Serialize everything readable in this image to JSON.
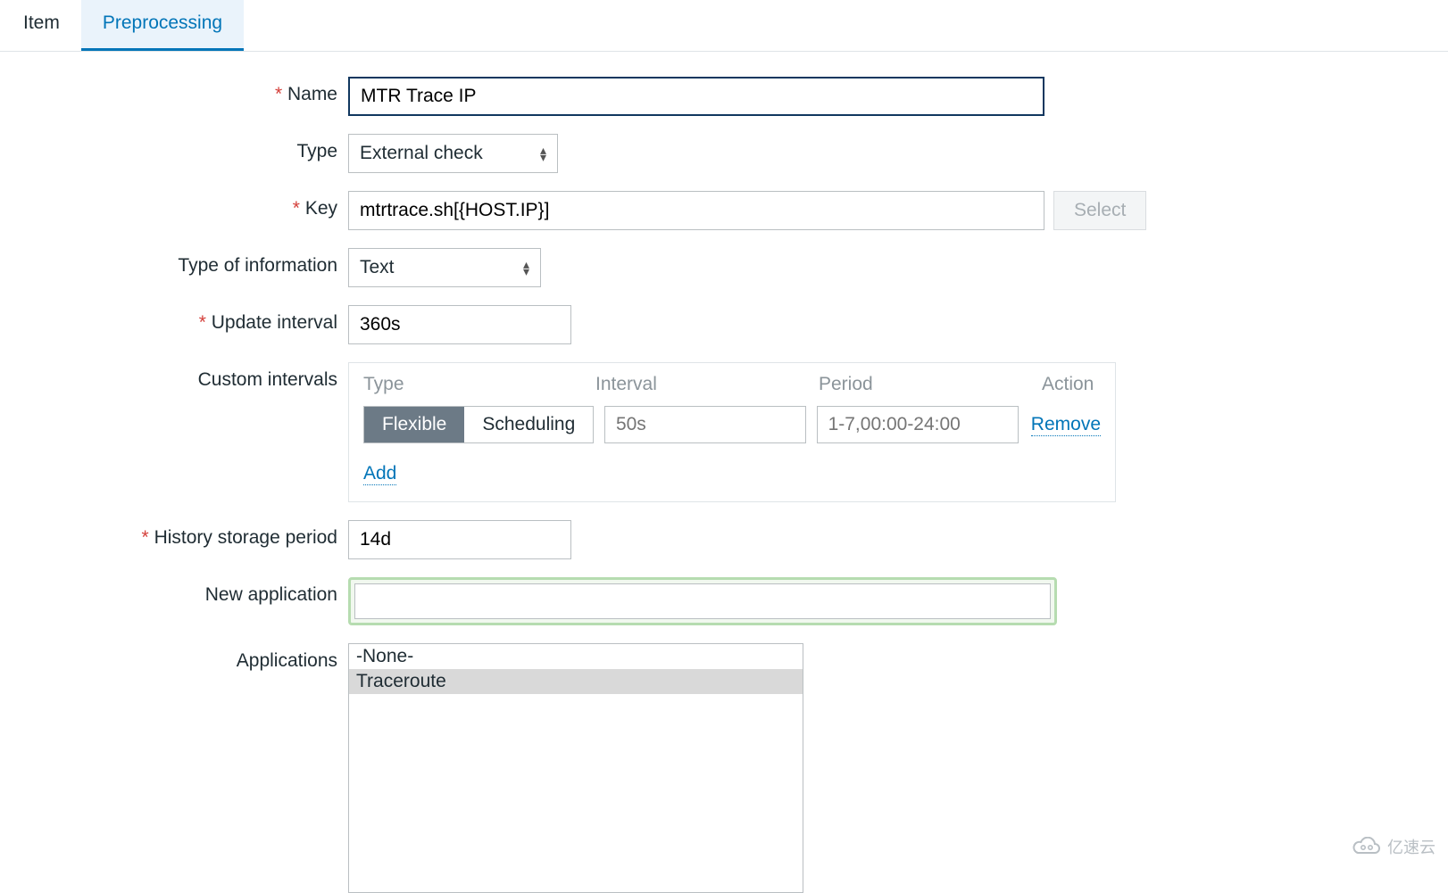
{
  "tabs": {
    "item": "Item",
    "preprocessing": "Preprocessing"
  },
  "labels": {
    "name": "Name",
    "type": "Type",
    "key": "Key",
    "type_of_info": "Type of information",
    "update_interval": "Update interval",
    "custom_intervals": "Custom intervals",
    "history_storage": "History storage period",
    "new_application": "New application",
    "applications": "Applications"
  },
  "fields": {
    "name": "MTR Trace IP",
    "type": "External check",
    "key": "mtrtrace.sh[{HOST.IP}]",
    "type_of_info": "Text",
    "update_interval": "360s",
    "history_storage": "14d",
    "new_application": ""
  },
  "buttons": {
    "select": "Select",
    "flexible": "Flexible",
    "scheduling": "Scheduling",
    "remove": "Remove",
    "add": "Add"
  },
  "custom_intervals": {
    "headers": {
      "type": "Type",
      "interval": "Interval",
      "period": "Period",
      "action": "Action"
    },
    "row": {
      "interval_placeholder": "50s",
      "period_placeholder": "1-7,00:00-24:00"
    }
  },
  "applications": {
    "options": [
      "-None-",
      "Traceroute"
    ],
    "selected": "Traceroute"
  },
  "watermark": "亿速云"
}
